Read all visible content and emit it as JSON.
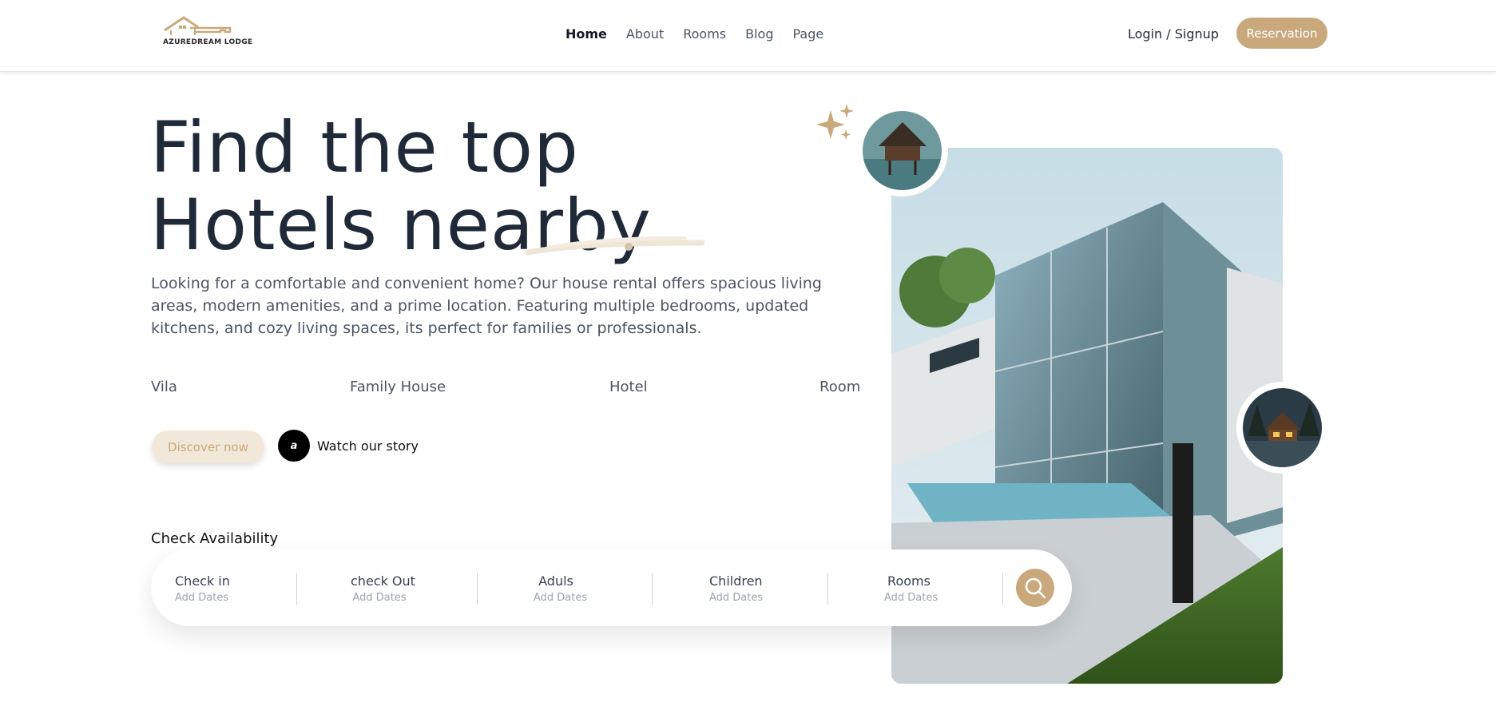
{
  "header": {
    "logo_text": "AZUREDREAM LODGE",
    "nav": [
      "Home",
      "About",
      "Rooms",
      "Blog",
      "Page"
    ],
    "active_nav": "Home",
    "login_label": "Login / Signup",
    "reservation_label": "Reservation"
  },
  "hero": {
    "title_line1": "Find the top",
    "title_line2": "Hotels nearby",
    "description": "Looking for a comfortable and convenient home? Our house rental offers spacious living areas, modern amenities, and a prime location. Featuring multiple bedrooms, updated kitchens, and cozy living spaces, its perfect for families or professionals.",
    "categories": [
      "Vila",
      "Family House",
      "Hotel",
      "Room"
    ],
    "discover_label": "Discover now",
    "watch_icon_glyph": "a",
    "watch_label": "Watch our story"
  },
  "availability": {
    "heading": "Check Availability",
    "fields": [
      {
        "label": "Check in",
        "sub": "Add Dates"
      },
      {
        "label": "check Out",
        "sub": "Add Dates"
      },
      {
        "label": "Aduls",
        "sub": "Add Dates"
      },
      {
        "label": "Children",
        "sub": "Add Dates"
      },
      {
        "label": "Rooms",
        "sub": "Add Dates"
      }
    ]
  },
  "colors": {
    "accent": "#c9a97c",
    "accent_light": "#f2e8da",
    "text_dark": "#1f2937"
  },
  "icons": {
    "search": "search-icon",
    "sparkle": "sparkle-icon",
    "play": "play-icon"
  }
}
